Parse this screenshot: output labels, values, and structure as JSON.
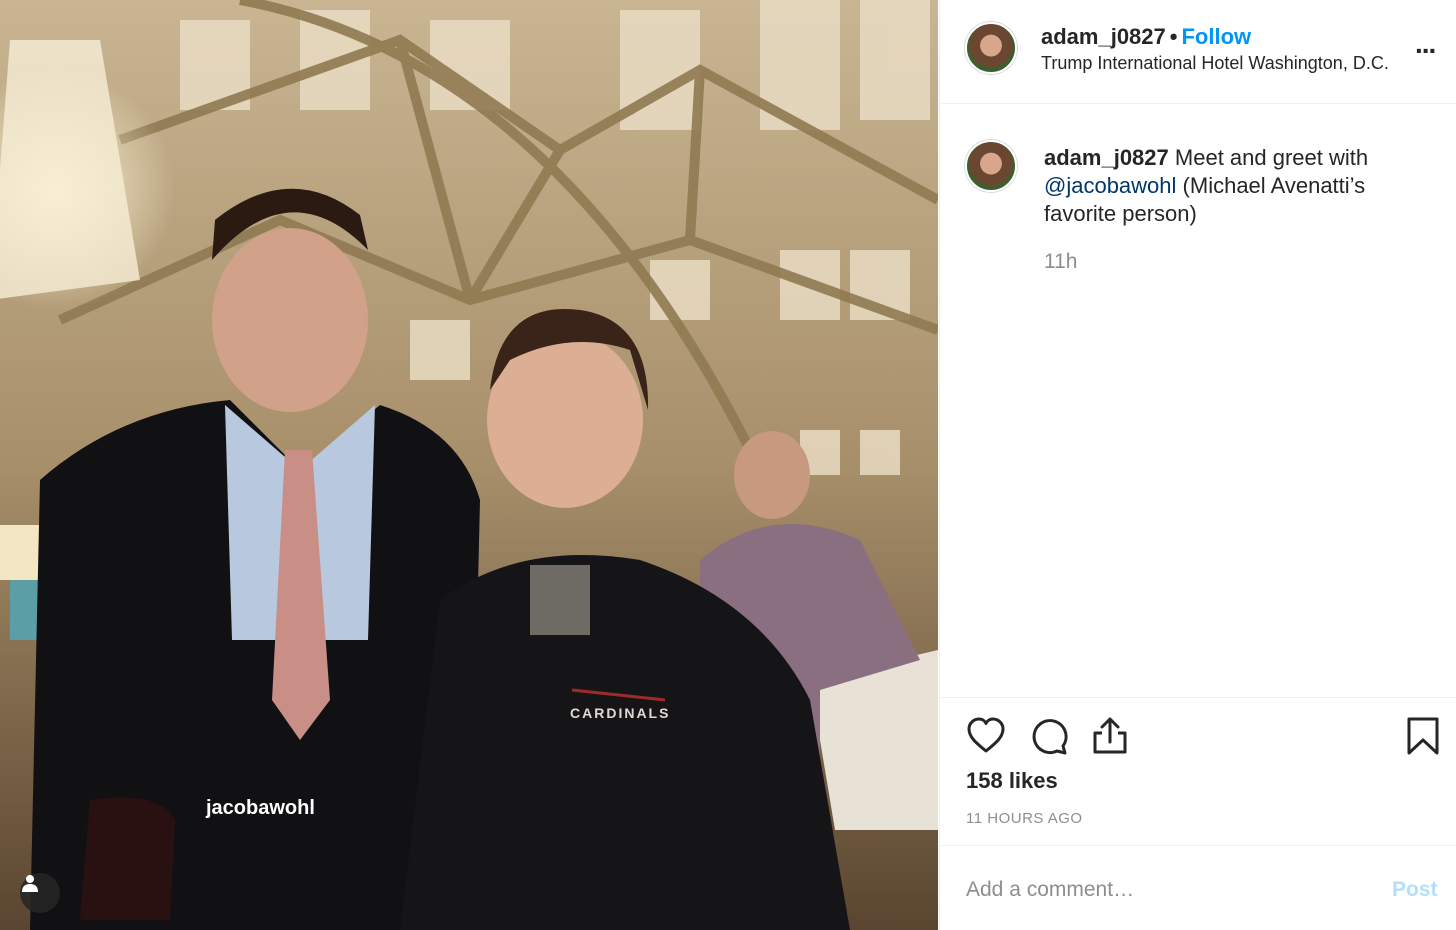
{
  "post": {
    "username": "adam_j0827",
    "follow_label": "Follow",
    "separator": "•",
    "location": "Trump International Hotel Washington, D.C.",
    "more_label": "...",
    "caption_username": "adam_j0827",
    "caption_text": "Meet and greet with",
    "caption_mention": "@jacobawohl",
    "caption_tail": "(Michael Avenatti’s favorite person)",
    "time_ago": "11h",
    "likes": "158 likes",
    "posted_ago": "11 HOURS AGO",
    "comment_placeholder": "Add a comment…",
    "post_label": "Post",
    "photo_tag": "jacobawohl",
    "sweater_text": "CARDINALS"
  },
  "colors": {
    "follow": "#0095f6",
    "mention": "#00376b",
    "muted": "#8e8e8e",
    "post_disabled": "#b2dffc"
  },
  "icons": [
    "heart-icon",
    "comment-icon",
    "share-icon",
    "bookmark-icon",
    "user-tag-icon",
    "more-icon"
  ]
}
